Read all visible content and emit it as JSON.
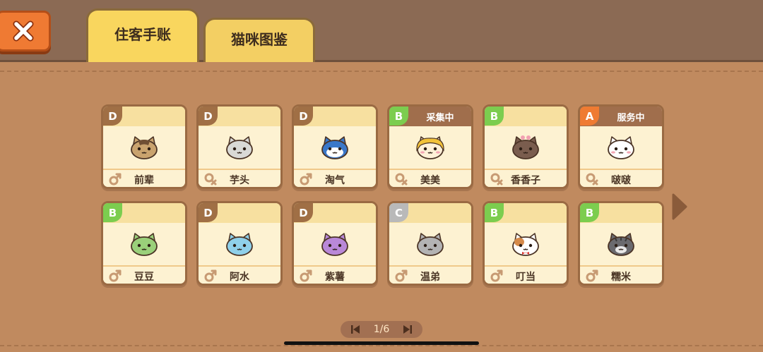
{
  "tabs": [
    {
      "label": "住客手账",
      "active": true
    },
    {
      "label": "猫咪图鉴",
      "active": false
    }
  ],
  "grade_colors": {
    "A": "#ef7b32",
    "B": "#7ccd4f",
    "C": "#b9b9b9",
    "D": "#a06f45"
  },
  "cats": [
    {
      "grade": "D",
      "status": "",
      "gender": "male",
      "name": "前辈",
      "fur": "#c9a36e",
      "patch": "#6f4f34",
      "icon": "brown-tabby-cat-icon"
    },
    {
      "grade": "D",
      "status": "",
      "gender": "female",
      "name": "芋头",
      "fur": "#d9d9d6",
      "patch": "#8d8d8d",
      "icon": "grey-owl-cat-icon"
    },
    {
      "grade": "D",
      "status": "",
      "gender": "male",
      "name": "淘气",
      "fur": "#3a78c9",
      "patch": "#ffffff",
      "icon": "blue-cat-icon"
    },
    {
      "grade": "B",
      "status": "采集中",
      "gender": "female",
      "name": "美美",
      "fur": "#fff1d8",
      "patch": "#f2c23a",
      "icon": "blonde-cat-icon"
    },
    {
      "grade": "B",
      "status": "",
      "gender": "female",
      "name": "香香子",
      "fur": "#7a5d4e",
      "patch": "#f29fb1",
      "icon": "brown-bow-cat-icon"
    },
    {
      "grade": "A",
      "status": "服务中",
      "gender": "female",
      "name": "啵啵",
      "fur": "#ffffff",
      "patch": "#f4a7b5",
      "icon": "white-pink-cat-icon"
    },
    {
      "grade": "B",
      "status": "",
      "gender": "male",
      "name": "豆豆",
      "fur": "#9ad07a",
      "patch": "#5f9a3e",
      "icon": "green-cat-icon"
    },
    {
      "grade": "D",
      "status": "",
      "gender": "male",
      "name": "阿水",
      "fur": "#8fd0ea",
      "patch": "#4aa3cc",
      "icon": "light-blue-cat-icon"
    },
    {
      "grade": "D",
      "status": "",
      "gender": "male",
      "name": "紫薯",
      "fur": "#b988d8",
      "patch": "#8a5bb3",
      "icon": "purple-cat-icon"
    },
    {
      "grade": "C",
      "status": "",
      "gender": "male",
      "name": "温弟",
      "fur": "#b3b3b3",
      "patch": "#8c8c8c",
      "icon": "grey-cat-icon"
    },
    {
      "grade": "B",
      "status": "",
      "gender": "male",
      "name": "叮当",
      "fur": "#ffffff",
      "patch": "#d58a4a",
      "icon": "calico-bow-tie-cat-icon"
    },
    {
      "grade": "B",
      "status": "",
      "gender": "male",
      "name": "糯米",
      "fur": "#6a6a6e",
      "patch": "#e8e8e8",
      "icon": "grey-striped-cat-icon"
    }
  ],
  "pager": {
    "text": "1/6"
  }
}
